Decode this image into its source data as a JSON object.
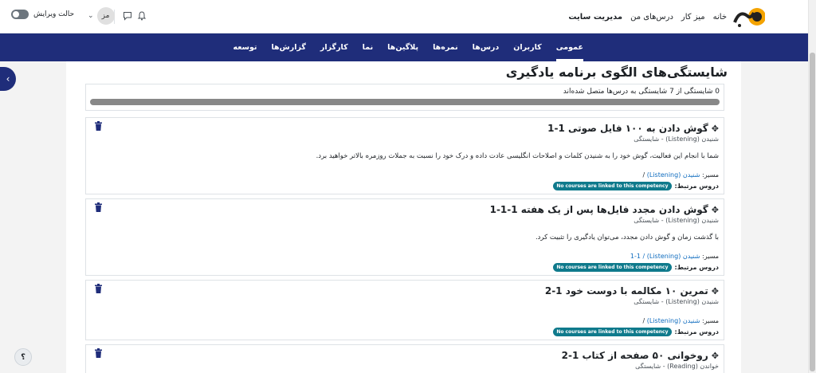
{
  "header": {
    "logo_alt": "وبو",
    "nav": [
      "خانه",
      "میز کار",
      "درس‌های من",
      "مدیریت سایت"
    ],
    "user_initials": "مز",
    "edit_mode_label": "حالت ویرایش"
  },
  "secondary_nav": {
    "items": [
      "عمومی",
      "کاربران",
      "درس‌ها",
      "نمره‌ها",
      "پلاگین‌ها",
      "نما",
      "کارگزار",
      "گزارش‌ها",
      "توسعه"
    ],
    "active_index": 0
  },
  "page": {
    "title": "شایستگی‌های الگوی برنامه یادگیری",
    "summary": "0 شایستگی از 7 شایستگی به درس‌ها متصل شده‌اند",
    "progress_fraction": 0
  },
  "labels": {
    "path": "مسیر:",
    "related_courses": "دروس مرتبط:",
    "no_courses_badge": "No courses are linked to this competency"
  },
  "competencies": [
    {
      "title": "گوش دادن به ۱۰۰ فایل صوتی 1-1",
      "subtitle": "شنیدن (Listening) - شایستگی",
      "description": "شما با انجام این فعالیت، گوش خود را به شنیدن کلمات و اصلاحات انگلیسی عادت داده و درک خود را نسبت به جملات روزمره بالاتر خواهید برد.",
      "path_link": "شنیدن (Listening)",
      "path_suffix": " /"
    },
    {
      "title": "گوش دادن مجدد فایل‌ها پس از یک هفته 1-1-1",
      "subtitle": "شنیدن (Listening) - شایستگی",
      "description": "با گذشت زمان و گوش دادن مجدد، می‌توان یادگیری را تثبیت کرد.",
      "path_link": "شنیدن (Listening)",
      "path_suffix": " / 1-1"
    },
    {
      "title": "تمرین ۱۰ مکالمه با دوست خود 1-2",
      "subtitle": "شنیدن (Listening) - شایستگی",
      "description": "",
      "path_link": "شنیدن (Listening)",
      "path_suffix": " /"
    },
    {
      "title": "روخوانی ۵۰ صفحه از کتاب 1-2",
      "subtitle": "خواندن (Reading) - شایستگی",
      "description": "",
      "path_link": "",
      "path_suffix": ""
    }
  ],
  "help_label": "؟"
}
